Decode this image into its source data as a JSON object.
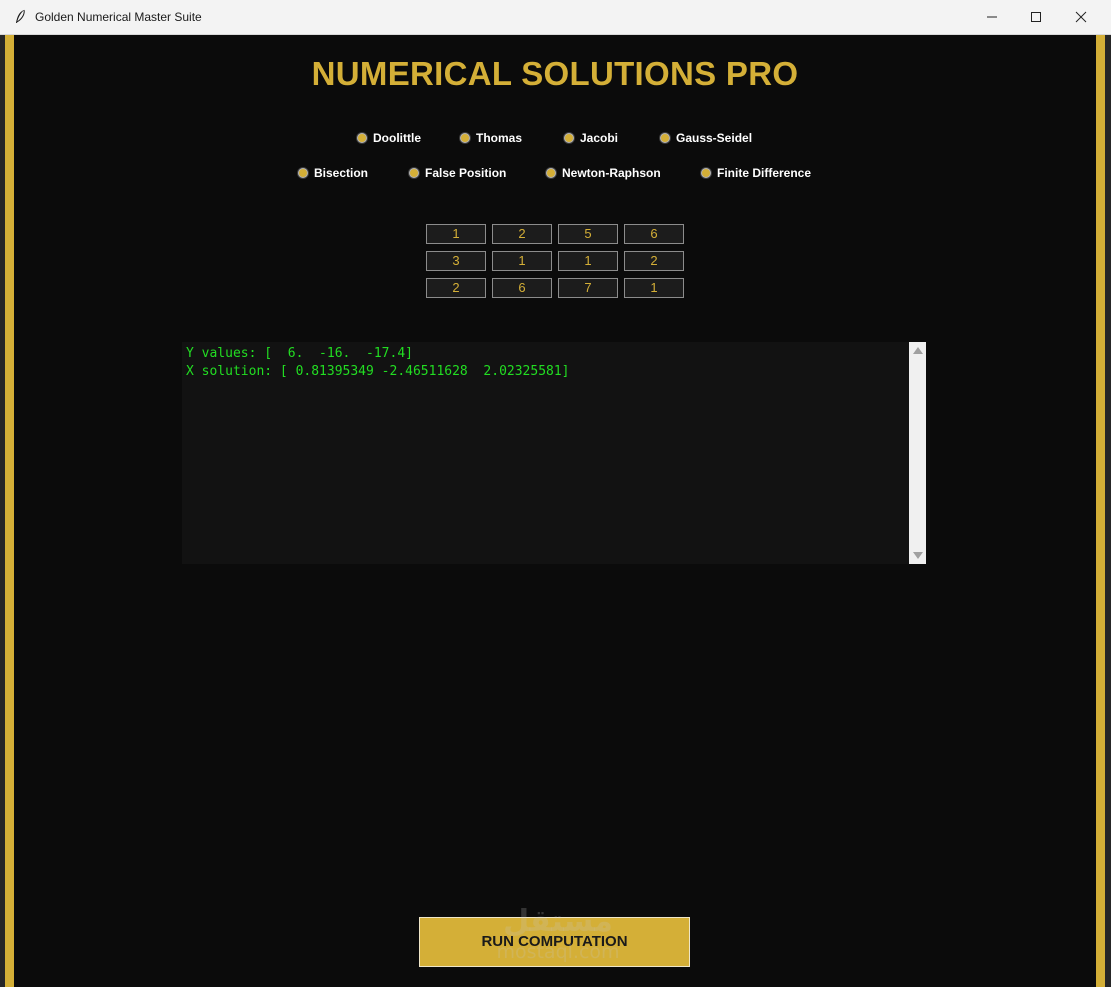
{
  "window": {
    "title": "Golden Numerical Master Suite",
    "icon": "feather-icon",
    "controls": [
      "minimize-icon",
      "maximize-icon",
      "close-icon"
    ]
  },
  "app": {
    "heading": "NUMERICAL SOLUTIONS PRO",
    "accent_color": "#d4af37",
    "background_color": "#0b0b0b"
  },
  "methods": {
    "row1": [
      "Doolittle",
      "Thomas",
      "Jacobi",
      "Gauss-Seidel"
    ],
    "row2": [
      "Bisection",
      "False Position",
      "Newton-Raphson",
      "Finite Difference"
    ]
  },
  "matrix": [
    [
      "1",
      "2",
      "5",
      "6"
    ],
    [
      "3",
      "1",
      "1",
      "2"
    ],
    [
      "2",
      "6",
      "7",
      "1"
    ]
  ],
  "output": {
    "lines": [
      "Y values: [  6.  -16.  -17.4]",
      "X solution: [ 0.81395349 -2.46511628  2.02325581]"
    ],
    "text_color": "#22dd22"
  },
  "run_button": {
    "label": "RUN COMPUTATION"
  },
  "watermark": {
    "arabic": "مستقل",
    "latin": "mostaql.com"
  }
}
